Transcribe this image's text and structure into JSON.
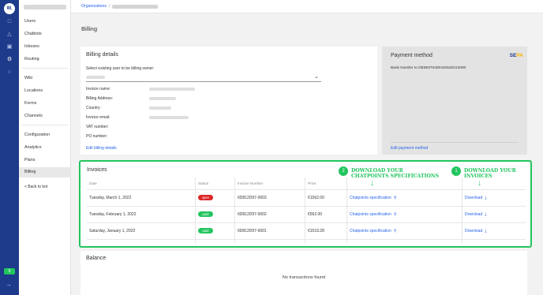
{
  "rail": {
    "logo": "W.",
    "badge": "0"
  },
  "sidebar": {
    "items": [
      {
        "label": "Users"
      },
      {
        "label": "Chatbots"
      },
      {
        "label": "Inboxes"
      },
      {
        "label": "Routing"
      },
      {
        "label": "Wiki"
      },
      {
        "label": "Locations"
      },
      {
        "label": "Forms"
      },
      {
        "label": "Channels"
      },
      {
        "label": "Configuration"
      },
      {
        "label": "Analytics"
      },
      {
        "label": "Plans"
      },
      {
        "label": "Billing"
      }
    ],
    "back": "< Back to bot"
  },
  "breadcrumb": {
    "root": "Organizations",
    "sep": "/"
  },
  "page": {
    "title": "Billing"
  },
  "billing_details": {
    "title": "Billing details",
    "select_label": "Select existing user to be billing owner:",
    "fields": [
      {
        "label": "Invoice name:"
      },
      {
        "label": "Billing Address:"
      },
      {
        "label": "Country:"
      },
      {
        "label": "Invoice email:"
      },
      {
        "label": "VAT number:"
      },
      {
        "label": "PO number:"
      }
    ],
    "edit_link": "Edit billing details"
  },
  "payment_method": {
    "title": "Payment method",
    "logo_a": "SE",
    "logo_b": "PA",
    "bank": "Bank transfer to DE89370400440532013000",
    "edit_link": "Edit payment method"
  },
  "invoices": {
    "title": "Invoices",
    "columns": [
      "Date",
      "Status",
      "Invoice Number",
      "Price"
    ],
    "rows": [
      {
        "date": "Tuesday, March 1, 2022",
        "status": "open",
        "status_color": "#dc2626",
        "number": "6D812D97-0003",
        "price": "€1562.00",
        "spec": "Chatpoints specification",
        "download": "Download"
      },
      {
        "date": "Tuesday, February 1, 2022",
        "status": "paid",
        "status_color": "#22c55e",
        "number": "6D812D97-0002",
        "price": "€562.00",
        "spec": "Chatpoints specification",
        "download": "Download"
      },
      {
        "date": "Saturday, January 1, 2022",
        "status": "paid",
        "status_color": "#22c55e",
        "number": "6D812D97-0001",
        "price": "€1519.28",
        "spec": "Chatpoints specification",
        "download": "Download"
      }
    ],
    "annotations": {
      "spec_num": "2",
      "spec_line1": "DOWNLOAD YOUR",
      "spec_line2": "CHATPOINTS SPECIFICATIONS",
      "dl_num": "1",
      "dl_line1": "DOWNLOAD YOUR",
      "dl_line2": "INVOICES"
    }
  },
  "balance": {
    "title": "Balance",
    "empty": "No transactions found"
  },
  "colors": {
    "rail": "#1e3a8a",
    "accent": "#2563eb",
    "highlight": "#22c55e",
    "open": "#dc2626",
    "paid": "#22c55e"
  },
  "icons": [
    "logo-icon",
    "chat-icon",
    "bot-icon",
    "inbox-icon",
    "settings-icon",
    "help-icon",
    "search-icon",
    "download-icon",
    "chevron-down-icon",
    "arrow-down-icon"
  ]
}
